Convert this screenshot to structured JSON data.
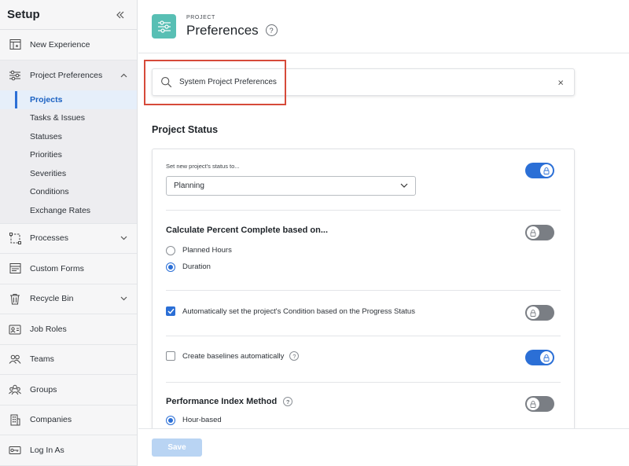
{
  "sidebar": {
    "title": "Setup",
    "items": [
      {
        "label": "New Experience",
        "icon": "new-experience-icon"
      },
      {
        "label": "Project Preferences",
        "icon": "sliders-icon"
      },
      {
        "label": "Processes",
        "icon": "processes-icon"
      },
      {
        "label": "Custom Forms",
        "icon": "custom-forms-icon"
      },
      {
        "label": "Recycle Bin",
        "icon": "trash-icon"
      },
      {
        "label": "Job Roles",
        "icon": "job-roles-icon"
      },
      {
        "label": "Teams",
        "icon": "teams-icon"
      },
      {
        "label": "Groups",
        "icon": "groups-icon"
      },
      {
        "label": "Companies",
        "icon": "companies-icon"
      },
      {
        "label": "Log In As",
        "icon": "log-in-as-icon"
      }
    ],
    "subitems": [
      {
        "label": "Projects",
        "active": true
      },
      {
        "label": "Tasks & Issues"
      },
      {
        "label": "Statuses"
      },
      {
        "label": "Priorities"
      },
      {
        "label": "Severities"
      },
      {
        "label": "Conditions"
      },
      {
        "label": "Exchange Rates"
      }
    ]
  },
  "header": {
    "kicker": "PROJECT",
    "title": "Preferences",
    "help": "?"
  },
  "search": {
    "value": "System Project Preferences",
    "clear": "×"
  },
  "section": {
    "title": "Project Status"
  },
  "settings": {
    "status_label": "Set new project's status to...",
    "status_value": "Planning",
    "percent_title": "Calculate Percent Complete based on...",
    "percent_options": [
      "Planned Hours",
      "Duration"
    ],
    "percent_selected": "Duration",
    "condition_label": "Automatically set the project's Condition based on the Progress Status",
    "condition_checked": true,
    "baselines_label": "Create baselines automatically",
    "baselines_checked": false,
    "pim_title": "Performance Index Method",
    "pim_option": "Hour-based",
    "toggles": [
      "on",
      "off",
      "off",
      "on",
      "off"
    ]
  },
  "footer": {
    "save_label": "Save"
  },
  "colors": {
    "accent": "#2b6fd6",
    "app_tile": "#58bfb4",
    "highlight": "#d64a3a"
  }
}
